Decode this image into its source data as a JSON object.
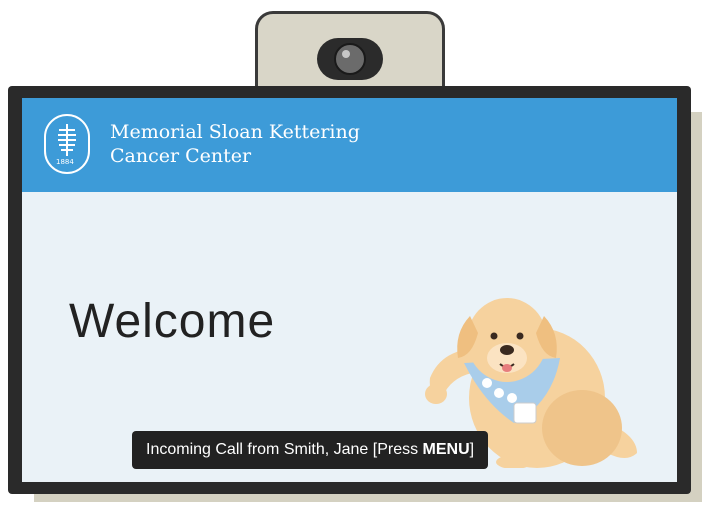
{
  "header": {
    "org_line1": "Memorial Sloan Kettering",
    "org_line2": "Cancer Center",
    "logo_year": "1884"
  },
  "main": {
    "welcome": "Welcome"
  },
  "notification": {
    "text": "Incoming Call from Smith, Jane [Press ",
    "key": "MENU",
    "suffix": "]"
  },
  "colors": {
    "header_bg": "#3d9bd8",
    "screen_bg": "#eaf2f7",
    "frame": "#2a2a2a"
  }
}
